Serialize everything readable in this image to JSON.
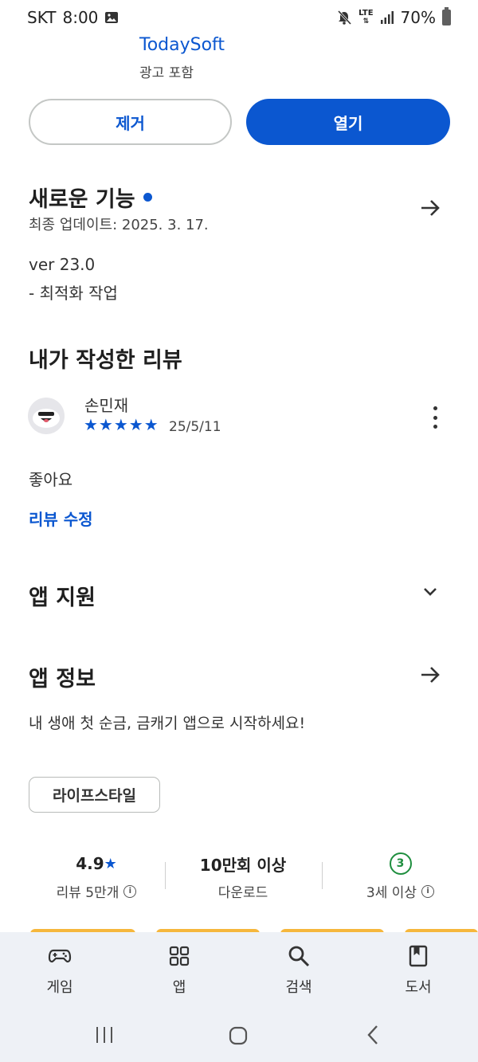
{
  "status_bar": {
    "carrier": "SKT",
    "time": "8:00",
    "network": "LTE",
    "battery": "70%"
  },
  "app": {
    "developer": "TodaySoft",
    "ads_label": "광고 포함"
  },
  "actions": {
    "remove_label": "제거",
    "open_label": "열기"
  },
  "whats_new": {
    "title": "새로운 기능",
    "last_updated": "최종 업데이트: 2025. 3. 17.",
    "version": "ver 23.0",
    "notes": "- 최적화 작업"
  },
  "my_review": {
    "title": "내가 작성한 리뷰",
    "reviewer": "손민재",
    "stars": "★★★★★",
    "rating": 5,
    "date": "25/5/11",
    "text": "좋아요",
    "edit_label": "리뷰 수정"
  },
  "app_support": {
    "title": "앱 지원"
  },
  "app_info": {
    "title": "앱 정보",
    "description": "내 생애 첫 순금, 금캐기 앱으로 시작하세요!"
  },
  "category_chip": "라이프스타일",
  "stats": {
    "rating_value": "4.9",
    "rating_star": "★",
    "reviews_label": "리뷰 5만개",
    "downloads_value": "10만회 이상",
    "downloads_label": "다운로드",
    "age_badge": "3",
    "age_label": "3세 이상"
  },
  "bottom_nav": [
    {
      "label": "게임",
      "icon": "gamepad-icon"
    },
    {
      "label": "앱",
      "icon": "apps-grid-icon"
    },
    {
      "label": "검색",
      "icon": "search-icon"
    },
    {
      "label": "도서",
      "icon": "book-icon"
    }
  ],
  "colors": {
    "accent": "#0b57d0",
    "age_green": "#1e8e3e",
    "nav_bg": "#eef1f6"
  }
}
